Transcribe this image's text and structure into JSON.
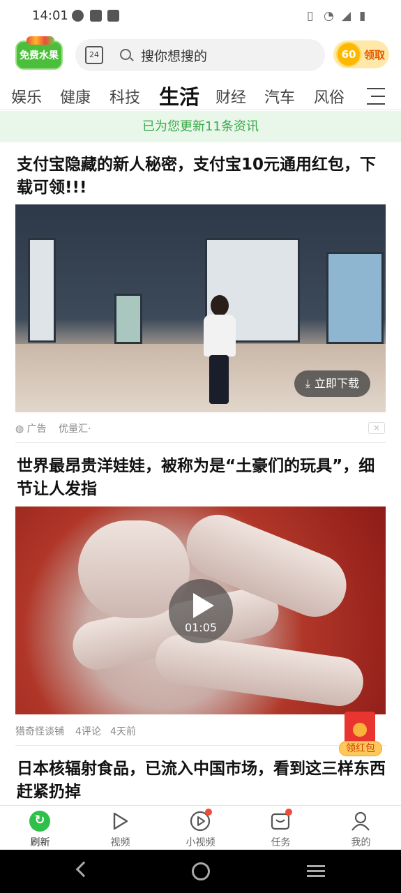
{
  "status_bar": {
    "time": "14:01"
  },
  "header": {
    "logo_text": "免费水果",
    "calendar_day": "24",
    "search_placeholder": "搜你想搜的",
    "coin_count": "60",
    "coin_button_label": "领取"
  },
  "channels": {
    "tabs": [
      "娱乐",
      "健康",
      "科技",
      "生活",
      "财经",
      "汽车",
      "风俗"
    ],
    "active": "生活"
  },
  "notice": "已为您更新11条资讯",
  "feed": [
    {
      "title": "支付宝隐藏的新人秘密，支付宝10元通用红包，下载可领!!!",
      "download_label": "立即下载",
      "ad_label": "广告",
      "source": "优量汇·",
      "close": "×"
    },
    {
      "title": "世界最昂贵洋娃娃，被称为是“土豪们的玩具”，细节让人发指",
      "duration": "01:05",
      "source": "猎奇怪谈铺",
      "comments": "4评论",
      "time": "4天前"
    },
    {
      "title": "日本核辐射食品，已流入中国市场，看到这三样东西赶紧扔掉"
    }
  ],
  "floating": {
    "red_packet_label": "领红包"
  },
  "bottom_nav": [
    {
      "label": "刷新",
      "icon": "refresh-icon",
      "badge": false
    },
    {
      "label": "视频",
      "icon": "play-icon",
      "badge": false
    },
    {
      "label": "小视频",
      "icon": "short-video-icon",
      "badge": true
    },
    {
      "label": "任务",
      "icon": "task-icon",
      "badge": true
    },
    {
      "label": "我的",
      "icon": "profile-icon",
      "badge": false
    }
  ],
  "colors": {
    "accent_green": "#2fbf4a",
    "notice_bg": "#e9f7ea",
    "badge_red": "#f04b3b"
  }
}
